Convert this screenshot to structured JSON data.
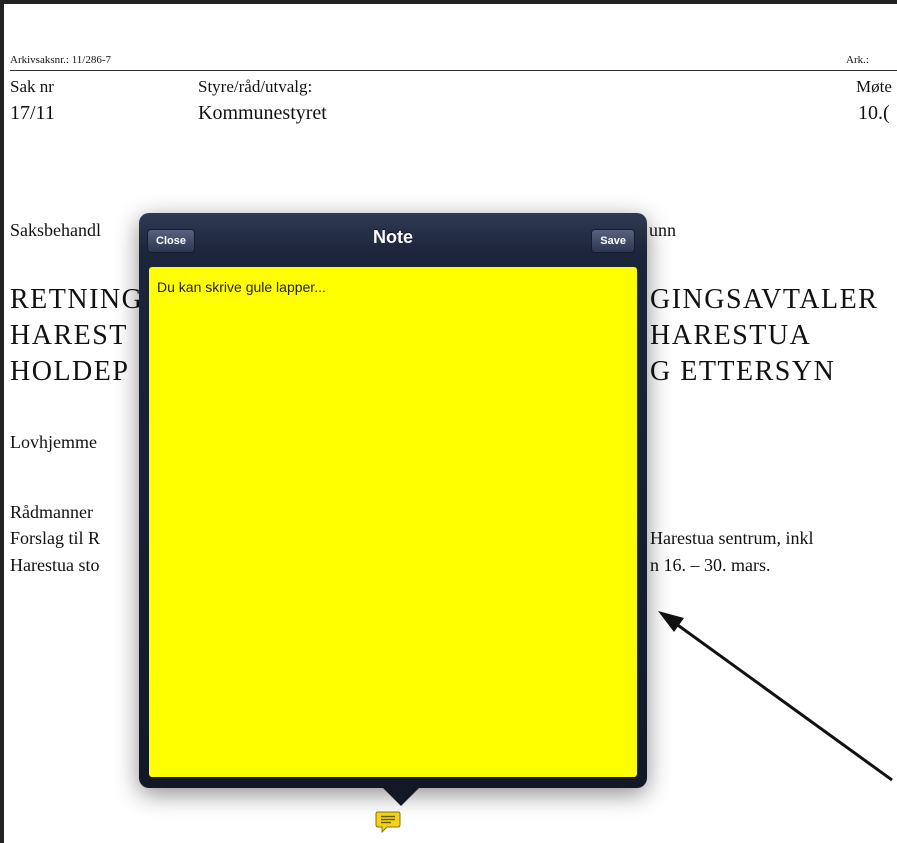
{
  "document": {
    "arkivsaksnr": "Arkivsaksnr.: 11/286-7",
    "ark": "Ark.:",
    "col1_header": "Sak nr",
    "col2_header": "Styre/råd/utvalg:",
    "col3_header": "Møte",
    "col1_value": "17/11",
    "col2_value": "Kommunestyret",
    "col3_value": "10.(",
    "saksbehandler_left": "Saksbehandl",
    "saksbehandler_right": "unn",
    "title_left": [
      "RETNING",
      "HAREST",
      "HOLDEP"
    ],
    "title_right": [
      "GINGSAVTALER",
      "HARESTUA",
      "G ETTERSYN"
    ],
    "lovhjemmel": "Lovhjemme",
    "radmannen": "Rådmanner",
    "forslag_left": "Forslag til R",
    "forslag_right": "Harestua sentrum, inkl",
    "harestua_left": "Harestua sto",
    "harestua_right": "n 16. – 30. mars."
  },
  "popover": {
    "title": "Note",
    "close_label": "Close",
    "save_label": "Save",
    "note_text": "Du kan skrive gule lapper..."
  },
  "colors": {
    "note_background": "#ffff00",
    "popover_background": "#1c2539",
    "note_icon": "#f2d21b"
  },
  "icons": {
    "note_icon": "speech-bubble-note-icon"
  }
}
